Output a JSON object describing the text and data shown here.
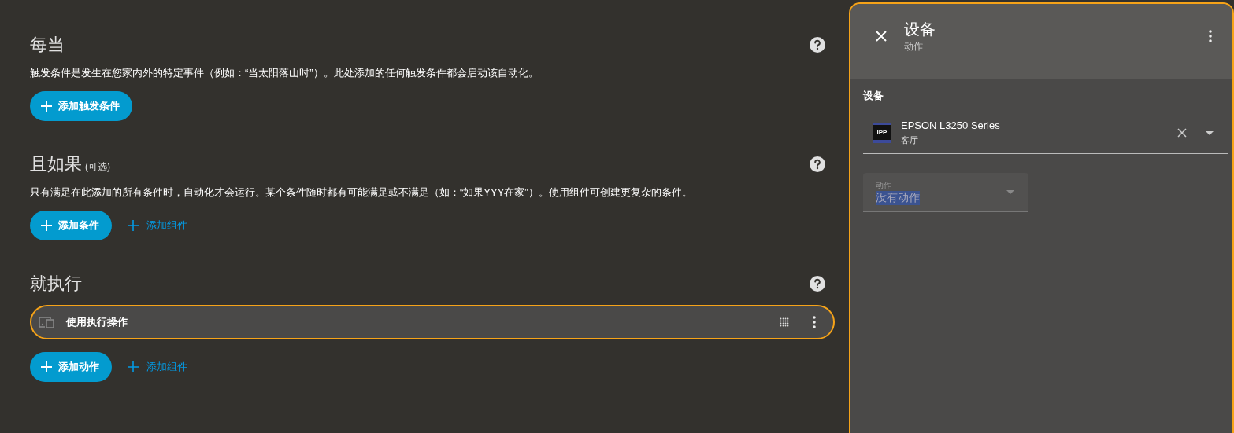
{
  "sections": [
    {
      "title": "每当",
      "description": "触发条件是发生在您家内外的特定事件（例如：“当太阳落山时”）。此处添加的任何触发条件都会启动该自动化。",
      "buttons": [
        {
          "label": "添加触发条件",
          "kind": "primary"
        }
      ]
    },
    {
      "title": "且如果",
      "optional": "(可选)",
      "description": "只有满足在此添加的所有条件时，自动化才会运行。某个条件随时都有可能满足或不满足（如：“如果YYY在家”）。使用组件可创建更复杂的条件。",
      "buttons": [
        {
          "label": "添加条件",
          "kind": "primary"
        },
        {
          "label": "添加组件",
          "kind": "text"
        }
      ]
    },
    {
      "title": "就执行",
      "items": [
        {
          "label": "使用执行操作",
          "selected": true
        }
      ],
      "buttons": [
        {
          "label": "添加动作",
          "kind": "primary"
        },
        {
          "label": "添加组件",
          "kind": "text"
        }
      ]
    }
  ],
  "panel": {
    "title": "设备",
    "subtitle": "动作",
    "device_label": "设备",
    "device": {
      "icon_text": "IPP",
      "name": "EPSON L3250 Series",
      "area": "客厅"
    },
    "action_field": {
      "label": "动作",
      "value": "没有动作",
      "text_highlighted": true
    }
  }
}
